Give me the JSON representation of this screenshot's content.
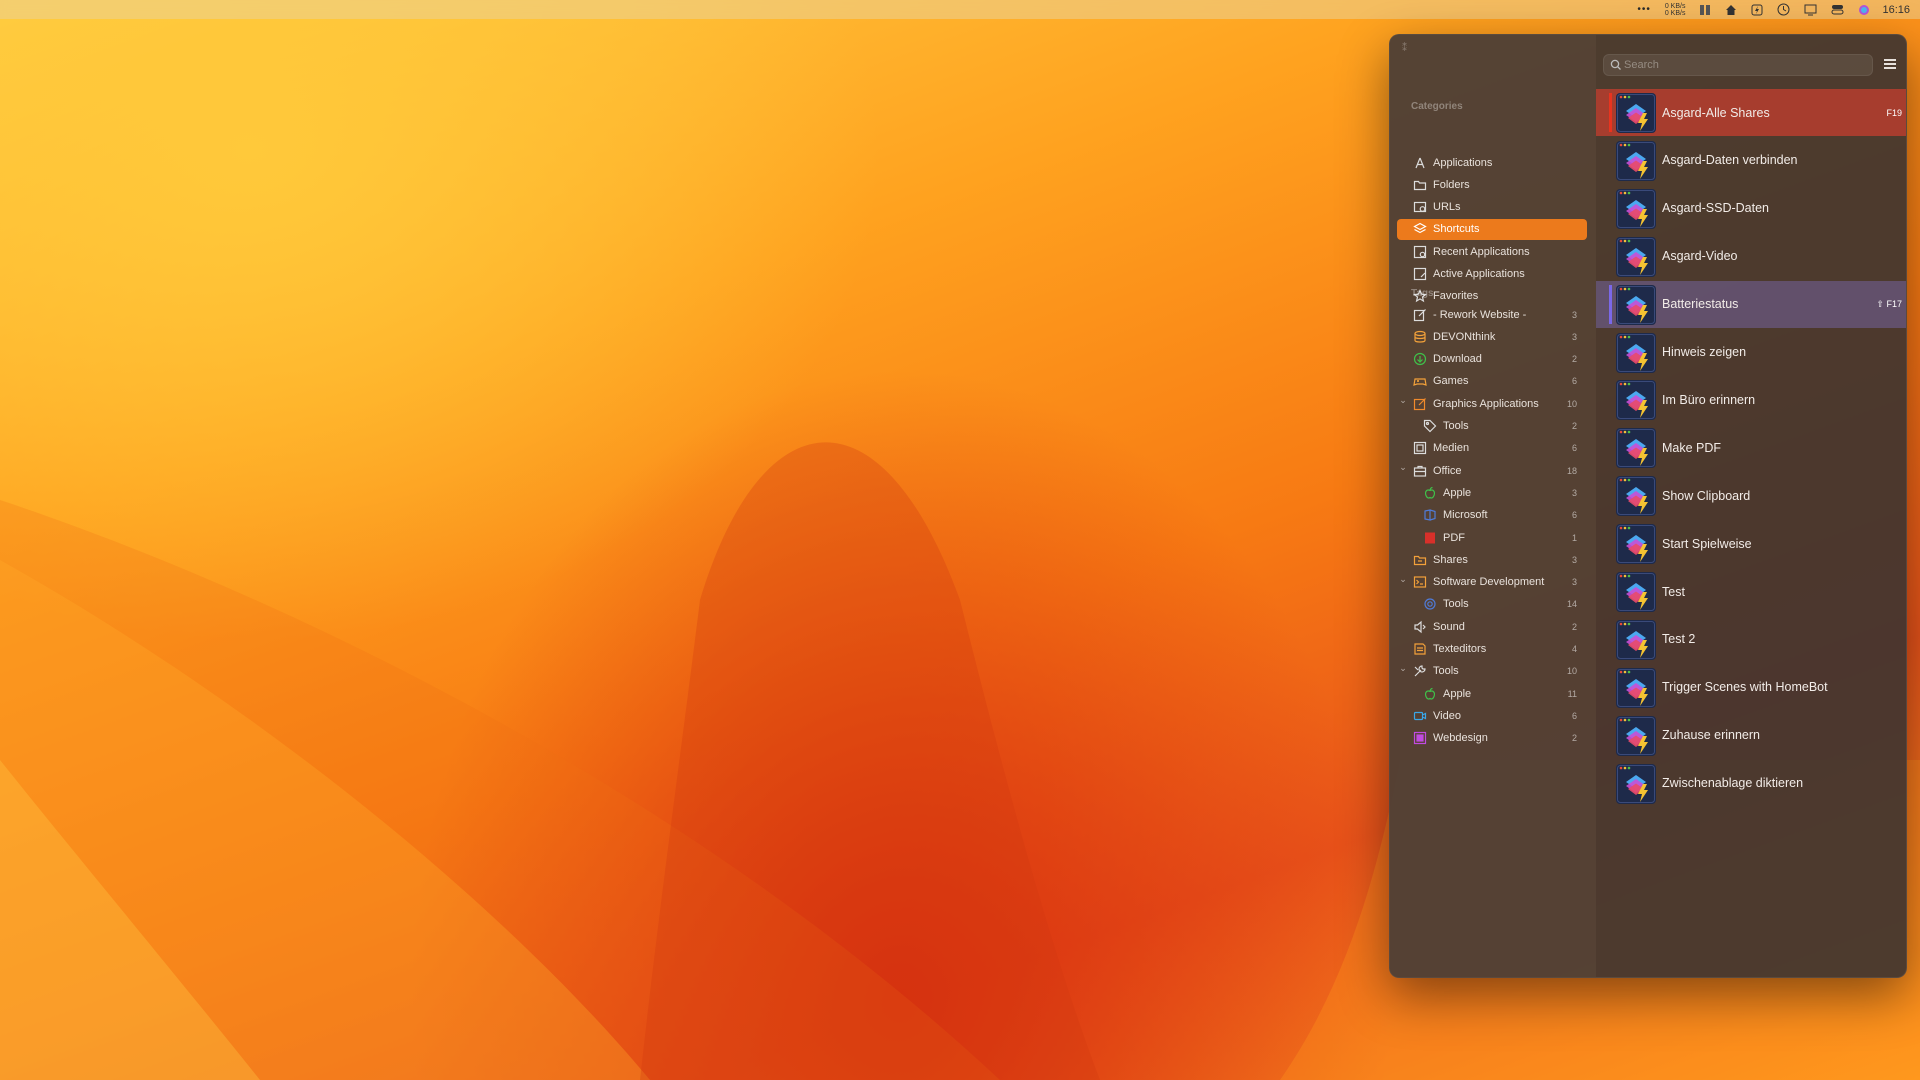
{
  "menubar": {
    "dots": "•••",
    "net_up": "0 KB/s",
    "net_down": "0 KB/s",
    "clock": "16:16"
  },
  "sidebar": {
    "categories_title": "Categories",
    "categories": [
      {
        "label": "Applications",
        "icon": "applications-icon",
        "selected": false
      },
      {
        "label": "Folders",
        "icon": "folder-icon",
        "selected": false
      },
      {
        "label": "URLs",
        "icon": "url-icon",
        "selected": false
      },
      {
        "label": "Shortcuts",
        "icon": "shortcuts-icon",
        "selected": true
      },
      {
        "label": "Recent Applications",
        "icon": "recent-icon",
        "selected": false
      },
      {
        "label": "Active Applications",
        "icon": "active-icon",
        "selected": false
      },
      {
        "label": "Favorites",
        "icon": "star-icon",
        "selected": false
      }
    ],
    "tags_title": "Tags",
    "tags": [
      {
        "label": "- Rework Website -",
        "count": "3",
        "icon": "edit-icon",
        "color": "#dcdcdc",
        "indent": 0,
        "expanded": null
      },
      {
        "label": "DEVONthink",
        "count": "3",
        "icon": "database-icon",
        "color": "#f2a13a",
        "indent": 0,
        "expanded": null
      },
      {
        "label": "Download",
        "count": "2",
        "icon": "download-icon",
        "color": "#3fc14a",
        "indent": 0,
        "expanded": null
      },
      {
        "label": "Games",
        "count": "6",
        "icon": "gamepad-icon",
        "color": "#f2a13a",
        "indent": 0,
        "expanded": null
      },
      {
        "label": "Graphics Applications",
        "count": "10",
        "icon": "brush-icon",
        "color": "#f08a2c",
        "indent": 0,
        "expanded": true
      },
      {
        "label": "Tools",
        "count": "2",
        "icon": "tag-icon",
        "color": "#dcdcdc",
        "indent": 1,
        "expanded": null
      },
      {
        "label": "Medien",
        "count": "6",
        "icon": "media-icon",
        "color": "#dcdcdc",
        "indent": 0,
        "expanded": null
      },
      {
        "label": "Office",
        "count": "18",
        "icon": "briefcase-icon",
        "color": "#dcdcdc",
        "indent": 0,
        "expanded": true
      },
      {
        "label": "Apple",
        "count": "3",
        "icon": "apple-icon",
        "color": "#3fc14a",
        "indent": 1,
        "expanded": null
      },
      {
        "label": "Microsoft",
        "count": "6",
        "icon": "microsoft-icon",
        "color": "#4f7bd8",
        "indent": 1,
        "expanded": null
      },
      {
        "label": "PDF",
        "count": "1",
        "icon": "pdf-icon",
        "color": "#d8302a",
        "indent": 1,
        "expanded": null
      },
      {
        "label": "Shares",
        "count": "3",
        "icon": "shares-icon",
        "color": "#f2a13a",
        "indent": 0,
        "expanded": null
      },
      {
        "label": "Software Development",
        "count": "3",
        "icon": "terminal-icon",
        "color": "#f2a13a",
        "indent": 0,
        "expanded": true
      },
      {
        "label": "Tools",
        "count": "14",
        "icon": "gear-icon",
        "color": "#4f7bd8",
        "indent": 1,
        "expanded": null
      },
      {
        "label": "Sound",
        "count": "2",
        "icon": "speaker-icon",
        "color": "#dcdcdc",
        "indent": 0,
        "expanded": null
      },
      {
        "label": "Texteditors",
        "count": "4",
        "icon": "text-edit-icon",
        "color": "#f2a13a",
        "indent": 0,
        "expanded": null
      },
      {
        "label": "Tools",
        "count": "10",
        "icon": "tools-icon",
        "color": "#dcdcdc",
        "indent": 0,
        "expanded": true
      },
      {
        "label": "Apple",
        "count": "11",
        "icon": "apple-icon",
        "color": "#3fc14a",
        "indent": 1,
        "expanded": null
      },
      {
        "label": "Video",
        "count": "6",
        "icon": "video-icon",
        "color": "#3aa7e8",
        "indent": 0,
        "expanded": null
      },
      {
        "label": "Webdesign",
        "count": "2",
        "icon": "webdesign-icon",
        "color": "#c04be0",
        "indent": 0,
        "expanded": null
      }
    ]
  },
  "search": {
    "placeholder": "Search",
    "value": ""
  },
  "shortcuts": [
    {
      "label": "Asgard-Alle Shares",
      "key": "F19",
      "highlight": "red"
    },
    {
      "label": "Asgard-Daten verbinden",
      "key": "",
      "highlight": ""
    },
    {
      "label": "Asgard-SSD-Daten",
      "key": "",
      "highlight": ""
    },
    {
      "label": "Asgard-Video",
      "key": "",
      "highlight": ""
    },
    {
      "label": "Batteriestatus",
      "key": "⇧ F17",
      "highlight": "purple"
    },
    {
      "label": "Hinweis zeigen",
      "key": "",
      "highlight": ""
    },
    {
      "label": "Im Büro erinnern",
      "key": "",
      "highlight": ""
    },
    {
      "label": "Make PDF",
      "key": "",
      "highlight": ""
    },
    {
      "label": "Show Clipboard",
      "key": "",
      "highlight": ""
    },
    {
      "label": "Start Spielweise",
      "key": "",
      "highlight": ""
    },
    {
      "label": "Test",
      "key": "",
      "highlight": ""
    },
    {
      "label": "Test 2",
      "key": "",
      "highlight": ""
    },
    {
      "label": "Trigger Scenes with HomeBot",
      "key": "",
      "highlight": ""
    },
    {
      "label": "Zuhause erinnern",
      "key": "",
      "highlight": ""
    },
    {
      "label": "Zwischenablage diktieren",
      "key": "",
      "highlight": ""
    }
  ],
  "colors": {
    "accent": "#ec7a1c",
    "selected_red": "#be3e30",
    "selected_red_bar": "#e8341f",
    "selected_purple": "#695880",
    "selected_purple_bar": "#7a68e8"
  }
}
